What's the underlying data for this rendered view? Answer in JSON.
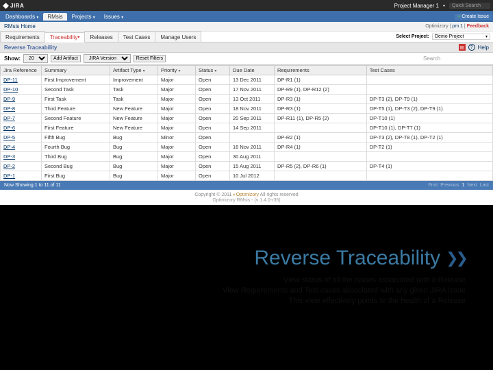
{
  "jira": {
    "logo": "JIRA",
    "user": "Project Manager 1",
    "quick_search": "Quick Search"
  },
  "bluenav": {
    "tabs": [
      "Dashboards",
      "RMsis",
      "Projects",
      "Issues"
    ],
    "active_index": 1,
    "create": "Create Issue"
  },
  "greybar": {
    "home": "RMsis Home",
    "right_prefix": "Optimizory",
    "right_link": "pm 1",
    "feedback": "Feedback"
  },
  "tabs": {
    "items": [
      "Requirements",
      "Traceability",
      "Releases",
      "Test Cases",
      "Manage Users"
    ],
    "active_index": 1,
    "select_label": "Select Project:",
    "select_value": "Demo Project"
  },
  "panel": {
    "title": "Reverse Traceability",
    "help": "Help",
    "help_q": "?"
  },
  "filters": {
    "show": "Show:",
    "show_val": "20",
    "add_artifact": "Add Artifact",
    "jira_version": "JIRA Version",
    "reset": "Reset Filters",
    "search_placeholder": "Search"
  },
  "columns": [
    "Jira Reference",
    "Summary",
    "Artifact Type",
    "Priority",
    "Status",
    "Due Date",
    "Requirements",
    "Test Cases"
  ],
  "rows": [
    {
      "ref": "DP-11",
      "summary": "First Improvement",
      "type": "Improvement",
      "priority": "Major",
      "status": "Open",
      "due": "13 Dec 2011",
      "req": "DP-R1 (1)",
      "tc": ""
    },
    {
      "ref": "DP-10",
      "summary": "Second Task",
      "type": "Task",
      "priority": "Major",
      "status": "Open",
      "due": "17 Nov 2011",
      "req": "DP-R9 (1), DP-R12 (2)",
      "tc": ""
    },
    {
      "ref": "DP-9",
      "summary": "First Task",
      "type": "Task",
      "priority": "Major",
      "status": "Open",
      "due": "13 Oct 2011",
      "req": "DP-R3 (1)",
      "tc": "DP-T3 (2), DP-T9 (1)"
    },
    {
      "ref": "DP-8",
      "summary": "Third Feature",
      "type": "New Feature",
      "priority": "Major",
      "status": "Open",
      "due": "18 Nov 2011",
      "req": "DP-R3 (1)",
      "tc": "DP-T5 (1), DP-T3 (2), DP-T9 (1)"
    },
    {
      "ref": "DP-7",
      "summary": "Second Feature",
      "type": "New Feature",
      "priority": "Major",
      "status": "Open",
      "due": "20 Sep 2011",
      "req": "DP-R11 (1), DP-R5 (2)",
      "tc": "DP-T10 (1)"
    },
    {
      "ref": "DP-6",
      "summary": "First Feature",
      "type": "New Feature",
      "priority": "Major",
      "status": "Open",
      "due": "14 Sep 2011",
      "req": "",
      "tc": "DP-T10 (1), DP-T7 (1)"
    },
    {
      "ref": "DP-5",
      "summary": "Fifth Bug",
      "type": "Bug",
      "priority": "Minor",
      "status": "Open",
      "due": "",
      "req": "DP-R2 (1)",
      "tc": "DP-T3 (2), DP-T8 (1), DP-T2 (1)"
    },
    {
      "ref": "DP-4",
      "summary": "Fourth Bug",
      "type": "Bug",
      "priority": "Major",
      "status": "Open",
      "due": "16 Nov 2011",
      "req": "DP-R4 (1)",
      "tc": "DP-T2 (1)"
    },
    {
      "ref": "DP-3",
      "summary": "Third Bug",
      "type": "Bug",
      "priority": "Major",
      "status": "Open",
      "due": "30 Aug 2011",
      "req": "",
      "tc": ""
    },
    {
      "ref": "DP-2",
      "summary": "Second Bug",
      "type": "Bug",
      "priority": "Major",
      "status": "Open",
      "due": "15 Aug 2011",
      "req": "DP-R5 (2), DP-R6 (1)",
      "tc": "DP-T4 (1)"
    },
    {
      "ref": "DP-1",
      "summary": "First Bug",
      "type": "Bug",
      "priority": "Major",
      "status": "Open",
      "due": "10 Jul 2012",
      "req": "",
      "tc": ""
    }
  ],
  "footer": {
    "showing": "Now Showing 1 to 11 of 11",
    "first": "First",
    "prev": "Previous",
    "page": "1",
    "next": "Next",
    "last": "Last"
  },
  "copyright": {
    "line": "Copyright © 2011",
    "brand": "Optimizory",
    "tail": "All rights reserved",
    "version": "Optimizory RMsis - (v 1.4.0-r35)"
  },
  "slide": {
    "title": "Reverse Traceability",
    "l1": "View status of all the issues associated with a Release",
    "l2": "View Requirements and Test cases associated with any given JIRA issue",
    "l3": "This view effectively points to the health of a Release"
  }
}
